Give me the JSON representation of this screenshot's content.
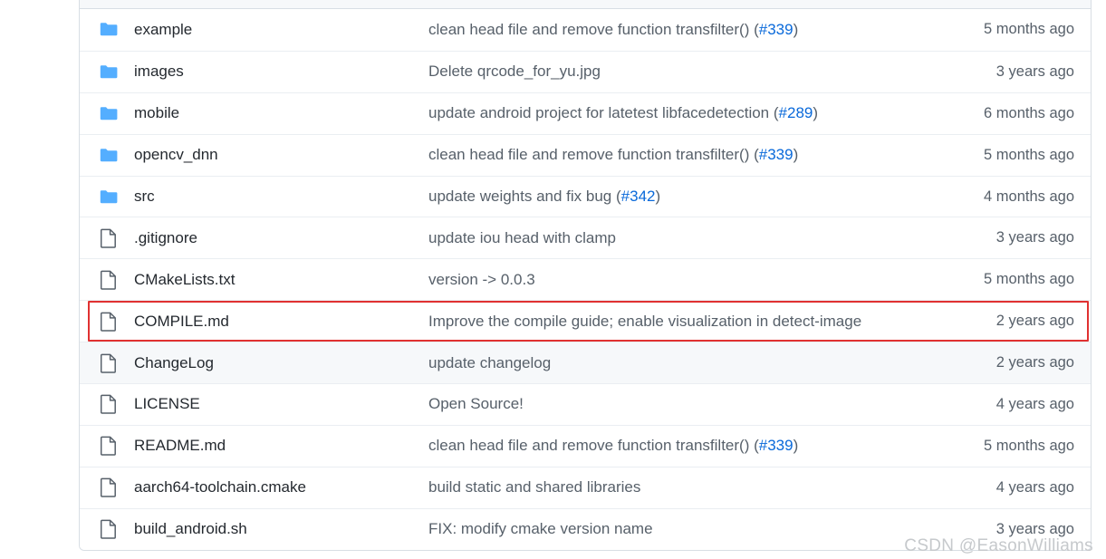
{
  "colors": {
    "folder_icon": "#54aeff",
    "file_icon_stroke": "#57606a",
    "link": "#0969da",
    "annotation_box": "#e03131",
    "row_border": "#eaeef2",
    "table_border": "#d8dee4",
    "striped_row_bg": "#f6f8fa",
    "watermark": "#c6c9cc"
  },
  "watermark": {
    "text": "CSDN @EasonWilliams"
  },
  "file_list": {
    "rows": [
      {
        "icon": "folder-icon",
        "type": "folder",
        "name": "example",
        "message_prefix": "clean head file and remove function transfilter() ",
        "message_link": "#339",
        "time": "5 months ago",
        "striped": false,
        "annotated": false
      },
      {
        "icon": "folder-icon",
        "type": "folder",
        "name": "images",
        "message_prefix": "Delete qrcode_for_yu.jpg",
        "message_link": "",
        "time": "3 years ago",
        "striped": false,
        "annotated": false
      },
      {
        "icon": "folder-icon",
        "type": "folder",
        "name": "mobile",
        "message_prefix": "update android project for latetest libfacedetection ",
        "message_link": "#289",
        "time": "6 months ago",
        "striped": false,
        "annotated": false
      },
      {
        "icon": "folder-icon",
        "type": "folder",
        "name": "opencv_dnn",
        "message_prefix": "clean head file and remove function transfilter() ",
        "message_link": "#339",
        "time": "5 months ago",
        "striped": false,
        "annotated": false
      },
      {
        "icon": "folder-icon",
        "type": "folder",
        "name": "src",
        "message_prefix": "update weights and fix bug ",
        "message_link": "#342",
        "time": "4 months ago",
        "striped": false,
        "annotated": false
      },
      {
        "icon": "file-icon",
        "type": "file",
        "name": ".gitignore",
        "message_prefix": "update iou head with clamp",
        "message_link": "",
        "time": "3 years ago",
        "striped": false,
        "annotated": false
      },
      {
        "icon": "file-icon",
        "type": "file",
        "name": "CMakeLists.txt",
        "message_prefix": "version -> 0.0.3",
        "message_link": "",
        "time": "5 months ago",
        "striped": false,
        "annotated": false
      },
      {
        "icon": "file-icon",
        "type": "file",
        "name": "COMPILE.md",
        "message_prefix": "Improve the compile guide; enable visualization in detect-image",
        "message_link": "",
        "time": "2 years ago",
        "striped": false,
        "annotated": true
      },
      {
        "icon": "file-icon",
        "type": "file",
        "name": "ChangeLog",
        "message_prefix": "update changelog",
        "message_link": "",
        "time": "2 years ago",
        "striped": true,
        "annotated": false
      },
      {
        "icon": "file-icon",
        "type": "file",
        "name": "LICENSE",
        "message_prefix": "Open Source!",
        "message_link": "",
        "time": "4 years ago",
        "striped": false,
        "annotated": false
      },
      {
        "icon": "file-icon",
        "type": "file",
        "name": "README.md",
        "message_prefix": "clean head file and remove function transfilter() ",
        "message_link": "#339",
        "time": "5 months ago",
        "striped": false,
        "annotated": false
      },
      {
        "icon": "file-icon",
        "type": "file",
        "name": "aarch64-toolchain.cmake",
        "message_prefix": "build static and shared libraries",
        "message_link": "",
        "time": "4 years ago",
        "striped": false,
        "annotated": false
      },
      {
        "icon": "file-icon",
        "type": "file",
        "name": "build_android.sh",
        "message_prefix": "FIX: modify cmake version name",
        "message_link": "",
        "time": "3 years ago",
        "striped": false,
        "annotated": false
      }
    ]
  }
}
